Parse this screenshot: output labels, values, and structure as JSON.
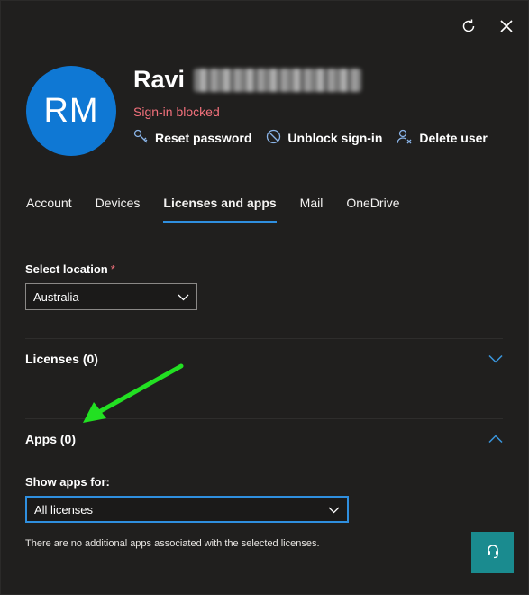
{
  "header": {
    "refresh_icon": "refresh-icon",
    "close_icon": "close-icon"
  },
  "user": {
    "initials": "RM",
    "first_name": "Ravi",
    "status": "Sign-in blocked"
  },
  "actions": {
    "reset_password": "Reset password",
    "unblock_signin": "Unblock sign-in",
    "delete_user": "Delete user"
  },
  "tabs": [
    {
      "label": "Account",
      "active": false
    },
    {
      "label": "Devices",
      "active": false
    },
    {
      "label": "Licenses and apps",
      "active": true
    },
    {
      "label": "Mail",
      "active": false
    },
    {
      "label": "OneDrive",
      "active": false
    }
  ],
  "location": {
    "label": "Select location",
    "required_mark": "*",
    "value": "Australia"
  },
  "licenses": {
    "title": "Licenses (0)",
    "expanded": false
  },
  "apps": {
    "title": "Apps (0)",
    "expanded": true,
    "show_label": "Show apps for:",
    "value": "All licenses",
    "note": "There are no additional apps associated with the selected licenses."
  },
  "colors": {
    "accent": "#2f8fdf",
    "avatar": "#0f78d4",
    "status": "#f1707b",
    "help": "#1a8b8f",
    "annotation_arrow": "#22e022"
  }
}
